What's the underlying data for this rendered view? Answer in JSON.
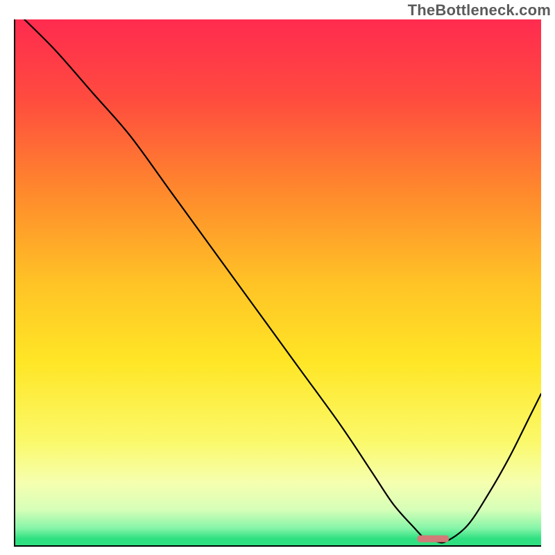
{
  "watermark": "TheBottleneck.com",
  "chart_data": {
    "type": "line",
    "title": "",
    "xlabel": "",
    "ylabel": "",
    "xlim": [
      0,
      100
    ],
    "ylim": [
      0,
      100
    ],
    "grid": false,
    "legend": false,
    "x": [
      2,
      8,
      15,
      22,
      30,
      38,
      46,
      54,
      62,
      68,
      72,
      76,
      78,
      80,
      82,
      86,
      90,
      94,
      98,
      100
    ],
    "y": [
      100,
      94,
      86,
      78,
      67,
      56,
      45,
      34,
      23,
      14,
      8,
      3.5,
      1.5,
      1,
      1,
      4,
      10,
      17,
      25,
      29
    ],
    "marker": {
      "x_range": [
        76.5,
        82.5
      ],
      "y": 1.5,
      "color": "#d17a78"
    },
    "background_gradient": {
      "stops": [
        {
          "offset": 0,
          "color": "#ff2b4f"
        },
        {
          "offset": 15,
          "color": "#ff4b3f"
        },
        {
          "offset": 33,
          "color": "#ff8a2c"
        },
        {
          "offset": 50,
          "color": "#ffc326"
        },
        {
          "offset": 65,
          "color": "#ffe626"
        },
        {
          "offset": 80,
          "color": "#fbf96a"
        },
        {
          "offset": 88,
          "color": "#f5ffb0"
        },
        {
          "offset": 93,
          "color": "#d6ffb8"
        },
        {
          "offset": 96.5,
          "color": "#86f5a8"
        },
        {
          "offset": 98.5,
          "color": "#2fe081"
        },
        {
          "offset": 100,
          "color": "#2fe081"
        }
      ]
    },
    "axis_color": "#000000"
  }
}
